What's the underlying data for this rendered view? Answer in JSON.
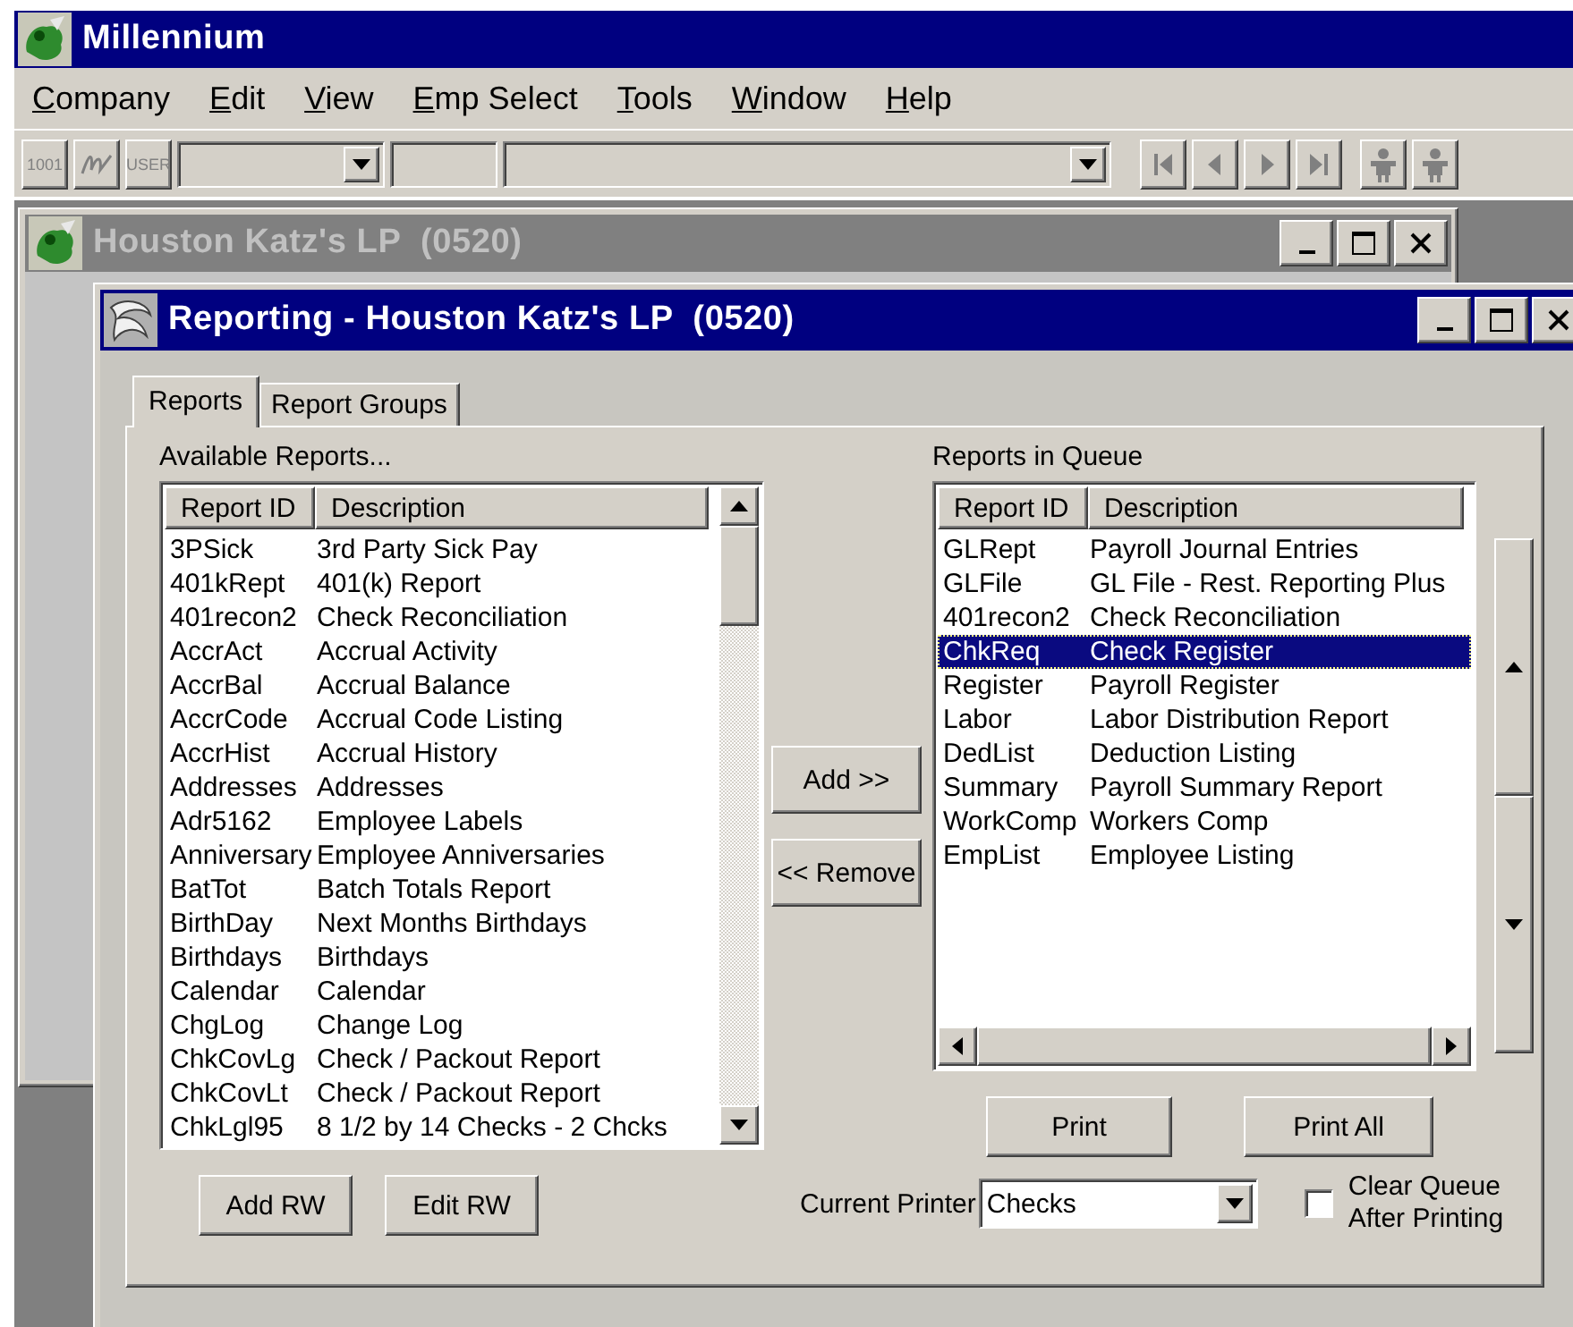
{
  "app": {
    "title": "Millennium"
  },
  "menu": [
    {
      "label": "Company",
      "accelerator": true
    },
    {
      "label": "Edit",
      "accelerator": true
    },
    {
      "label": "View",
      "accelerator": true
    },
    {
      "label": "Emp Select",
      "accelerator": true
    },
    {
      "label": "Tools",
      "accelerator": true
    },
    {
      "label": "Window",
      "accelerator": true
    },
    {
      "label": "Help",
      "accelerator": true
    }
  ],
  "toolbar": {
    "number_button": "1001",
    "user_button": "USER"
  },
  "company_window": {
    "title": "Houston Katz's LP  (0520)",
    "active": false
  },
  "reporting_window": {
    "title": "Reporting - Houston Katz's LP  (0520)",
    "active": true
  },
  "tabs": [
    {
      "label": "Reports",
      "selected": true
    },
    {
      "label": "Report Groups",
      "selected": false
    }
  ],
  "available": {
    "label": "Available Reports...",
    "columns": [
      "Report ID",
      "Description"
    ],
    "rows": [
      {
        "id": "3PSick",
        "description": "3rd Party Sick Pay",
        "selected": false
      },
      {
        "id": "401kRept",
        "description": "401(k) Report",
        "selected": false
      },
      {
        "id": "401recon2",
        "description": "Check Reconciliation",
        "selected": false
      },
      {
        "id": "AccrAct",
        "description": "Accrual Activity",
        "selected": false
      },
      {
        "id": "AccrBal",
        "description": "Accrual Balance",
        "selected": false
      },
      {
        "id": "AccrCode",
        "description": "Accrual Code Listing",
        "selected": false
      },
      {
        "id": "AccrHist",
        "description": "Accrual History",
        "selected": false
      },
      {
        "id": "Addresses",
        "description": "Addresses",
        "selected": false
      },
      {
        "id": "Adr5162",
        "description": "Employee Labels",
        "selected": false
      },
      {
        "id": "Anniversary",
        "description": "Employee Anniversaries",
        "selected": false
      },
      {
        "id": "BatTot",
        "description": "Batch Totals Report",
        "selected": false
      },
      {
        "id": "BirthDay",
        "description": "Next Months Birthdays",
        "selected": false
      },
      {
        "id": "Birthdays",
        "description": "Birthdays",
        "selected": false
      },
      {
        "id": "Calendar",
        "description": "Calendar",
        "selected": false
      },
      {
        "id": "ChgLog",
        "description": "Change Log",
        "selected": false
      },
      {
        "id": "ChkCovLg",
        "description": "Check /  Packout Report",
        "selected": false
      },
      {
        "id": "ChkCovLt",
        "description": "Check /  Packout Report",
        "selected": false
      },
      {
        "id": "ChkLgl95",
        "description": "8 1/2 by 14 Checks - 2 Chcks",
        "selected": false
      }
    ]
  },
  "queue": {
    "label": "Reports in Queue",
    "columns": [
      "Report ID",
      "Description"
    ],
    "rows": [
      {
        "id": "GLRept",
        "description": "Payroll Journal Entries",
        "selected": false
      },
      {
        "id": "GLFile",
        "description": "GL File - Rest. Reporting Plus",
        "selected": false
      },
      {
        "id": "401recon2",
        "description": "Check Reconciliation",
        "selected": false
      },
      {
        "id": "ChkReq",
        "description": "Check Register",
        "selected": true
      },
      {
        "id": "Register",
        "description": "Payroll Register",
        "selected": false
      },
      {
        "id": "Labor",
        "description": "Labor Distribution Report",
        "selected": false
      },
      {
        "id": "DedList",
        "description": "Deduction Listing",
        "selected": false
      },
      {
        "id": "Summary",
        "description": "Payroll Summary Report",
        "selected": false
      },
      {
        "id": "WorkComp",
        "description": "Workers Comp",
        "selected": false
      },
      {
        "id": "EmpList",
        "description": "Employee Listing",
        "selected": false
      }
    ]
  },
  "buttons": {
    "add": "Add >>",
    "remove": "<< Remove",
    "add_rw": "Add RW",
    "edit_rw": "Edit RW",
    "print": "Print",
    "print_all": "Print All"
  },
  "printer": {
    "label": "Current Printer",
    "value": "Checks"
  },
  "clear_queue": {
    "label": "Clear Queue After Printing",
    "checked": false
  }
}
